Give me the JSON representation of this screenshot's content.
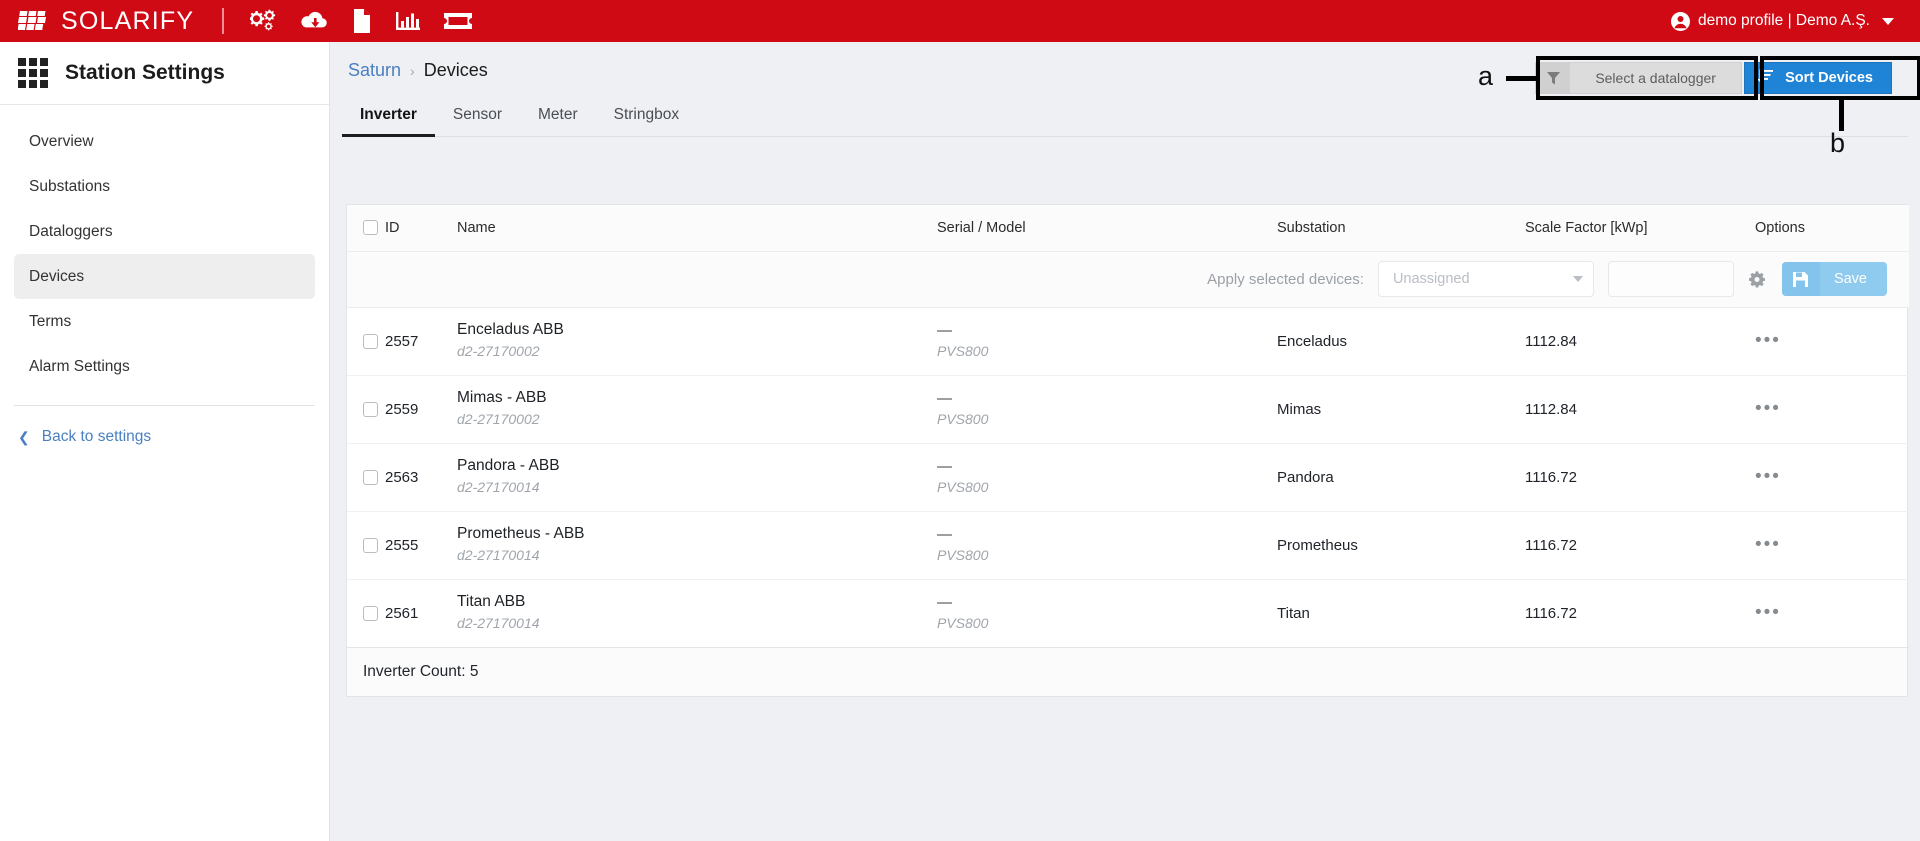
{
  "topbar": {
    "brand": "SOLARIFY",
    "icons": [
      {
        "name": "cogs-icon",
        "label": "Settings"
      },
      {
        "name": "cloud-download-icon",
        "label": "Downloads"
      },
      {
        "name": "file-document-icon",
        "label": "Reports"
      },
      {
        "name": "chart-bar-icon",
        "label": "Analytics"
      },
      {
        "name": "ticket-icon",
        "label": "Tickets"
      }
    ],
    "profile": "demo profile | Demo A.Ş.",
    "brand_color": "#d00a15"
  },
  "sidebar": {
    "title": "Station Settings",
    "items": [
      {
        "label": "Overview",
        "active": false
      },
      {
        "label": "Substations",
        "active": false
      },
      {
        "label": "Dataloggers",
        "active": false
      },
      {
        "label": "Devices",
        "active": true
      },
      {
        "label": "Terms",
        "active": false
      },
      {
        "label": "Alarm Settings",
        "active": false
      }
    ],
    "back_link": "Back to settings"
  },
  "breadcrumb": {
    "parent": "Saturn",
    "separator": "›",
    "current": "Devices"
  },
  "actions": {
    "datalogger_placeholder": "Select a datalogger",
    "sort_label": "Sort Devices",
    "sort_color": "#1f84d6",
    "annotation_a": "a",
    "annotation_b": "b"
  },
  "tabs": [
    {
      "label": "Inverter",
      "active": true
    },
    {
      "label": "Sensor",
      "active": false
    },
    {
      "label": "Meter",
      "active": false
    },
    {
      "label": "Stringbox",
      "active": false
    }
  ],
  "table": {
    "headers": [
      "ID",
      "Name",
      "Serial / Model",
      "Substation",
      "Scale Factor [kWp]",
      "Options"
    ],
    "apply_row": {
      "label": "Apply selected devices:",
      "substation_value": "Unassigned",
      "scale_factor_value": "",
      "save_label": "Save"
    },
    "rows": [
      {
        "id": "2557",
        "name": "Enceladus ABB",
        "subname": "d2-27170002",
        "serial": "—",
        "model": "PVS800",
        "substation": "Enceladus",
        "scale_factor": "1112.84",
        "options": "•••"
      },
      {
        "id": "2559",
        "name": "Mimas - ABB",
        "subname": "d2-27170002",
        "serial": "—",
        "model": "PVS800",
        "substation": "Mimas",
        "scale_factor": "1112.84",
        "options": "•••"
      },
      {
        "id": "2563",
        "name": "Pandora - ABB",
        "subname": "d2-27170014",
        "serial": "—",
        "model": "PVS800",
        "substation": "Pandora",
        "scale_factor": "1116.72",
        "options": "•••"
      },
      {
        "id": "2555",
        "name": "Prometheus - ABB",
        "subname": "d2-27170014",
        "serial": "—",
        "model": "PVS800",
        "substation": "Prometheus",
        "scale_factor": "1116.72",
        "options": "•••"
      },
      {
        "id": "2561",
        "name": "Titan ABB",
        "subname": "d2-27170014",
        "serial": "—",
        "model": "PVS800",
        "substation": "Titan",
        "scale_factor": "1116.72",
        "options": "•••"
      }
    ],
    "count_label": "Inverter Count: 5"
  }
}
